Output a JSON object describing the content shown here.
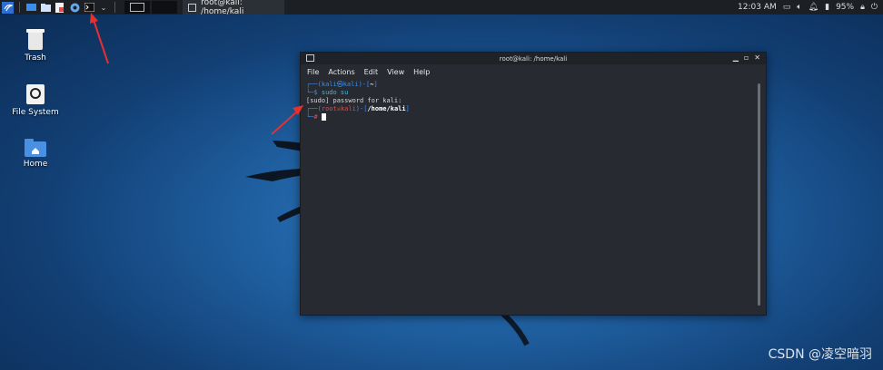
{
  "taskbar": {
    "task_title": "root@kali: /home/kali",
    "clock": "12:03 AM",
    "battery": "95%"
  },
  "desktop": {
    "icons": [
      {
        "label": "Trash"
      },
      {
        "label": "File System"
      },
      {
        "label": "Home"
      }
    ]
  },
  "terminal": {
    "title": "root@kali: /home/kali",
    "menu": [
      "File",
      "Actions",
      "Edit",
      "View",
      "Help"
    ],
    "line1_user": "kali",
    "line1_at": "㉿",
    "line1_host": "kali",
    "line1_dir": "~",
    "line2_cmd": "sudo su",
    "line3": "[sudo] password for kali:",
    "line4_user": "root",
    "line4_host": "kali",
    "line4_dir": "/home/kali",
    "prompt_symbol": "#"
  },
  "watermark": "CSDN @凌空暗羽",
  "colors": {
    "accent_blue": "#3b8eea",
    "root_red": "#e04b4b",
    "arrow_red": "#e53030"
  }
}
